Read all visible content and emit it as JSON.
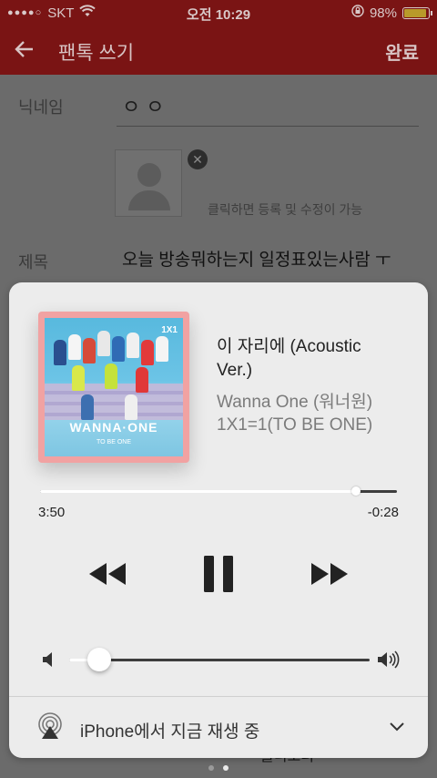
{
  "status": {
    "carrier": "SKT",
    "time": "오전 10:29",
    "battery": "98%"
  },
  "header": {
    "title": "팬톡 쓰기",
    "done": "완료"
  },
  "form": {
    "nickname_label": "닉네임",
    "nickname_value": "ㅇㅇ",
    "photo_hint": "클릭하면 등록 및 수정이 가능",
    "subject_label": "제목",
    "subject_value": "오늘 방송뭐하는지 일정표있는사람 ㅜ",
    "bottom_text": "를니오더"
  },
  "player": {
    "title": "이 자리에 (Acoustic Ver.)",
    "artist": "Wanna One (워너원)",
    "album": "1X1=1(TO BE ONE)",
    "elapsed": "3:50",
    "remaining": "-0:28",
    "progress": 0.885,
    "volume": 0.1,
    "output": "iPhone에서 지금 재생 중",
    "album_art": {
      "logo": "WANNA·ONE",
      "tagline": "TO BE ONE",
      "side": "1X1"
    }
  },
  "pager": {
    "count": 2,
    "active": 1
  }
}
